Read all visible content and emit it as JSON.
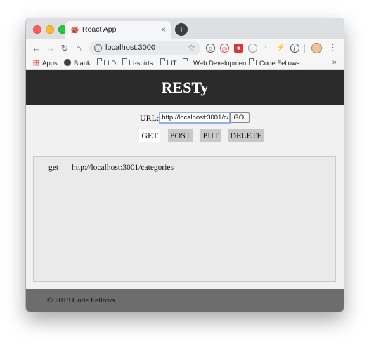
{
  "browser": {
    "tab": {
      "title": "React App",
      "favicon": "react-logo-icon",
      "close_label": "×"
    },
    "new_tab_label": "+",
    "toolbar": {
      "back": "←",
      "forward": "→",
      "reload": "↻",
      "home": "⌂",
      "address_info": "i",
      "address": "localhost:3000",
      "bookmark_star": "☆",
      "menu": "⋮"
    },
    "extensions": [
      "☺",
      "◎",
      "■",
      "◌",
      "⠂",
      "⚡",
      "i"
    ],
    "bookmarks": [
      {
        "label": "Apps",
        "icon": "apps-grid-icon"
      },
      {
        "label": "Blank",
        "icon": "globe-icon"
      },
      {
        "label": "LD",
        "icon": "folder-icon"
      },
      {
        "label": "t-shirts",
        "icon": "folder-icon"
      },
      {
        "label": "IT",
        "icon": "folder-icon"
      },
      {
        "label": "Web Development",
        "icon": "folder-icon"
      },
      {
        "label": "Code Fellows",
        "icon": "folder-icon"
      }
    ],
    "bookmarks_overflow": "»"
  },
  "app": {
    "title": "RESTy",
    "form": {
      "url_label": "URL:",
      "url_value": "http://localhost:3001/categories",
      "go_label": "GO!"
    },
    "methods": [
      {
        "label": "GET",
        "active": true
      },
      {
        "label": "POST",
        "active": false
      },
      {
        "label": "PUT",
        "active": false
      },
      {
        "label": "DELETE",
        "active": false
      }
    ],
    "history": [
      {
        "method": "get",
        "url": "http://localhost:3001/categories"
      }
    ],
    "footer": "© 2018 Code Fellows"
  },
  "colors": {
    "header_bg": "#2b2b2b",
    "footer_bg": "#6d6d6d",
    "method_bg": "#c8c8c8",
    "method_active_bg": "#ffffff",
    "results_bg": "#eaeaea"
  }
}
